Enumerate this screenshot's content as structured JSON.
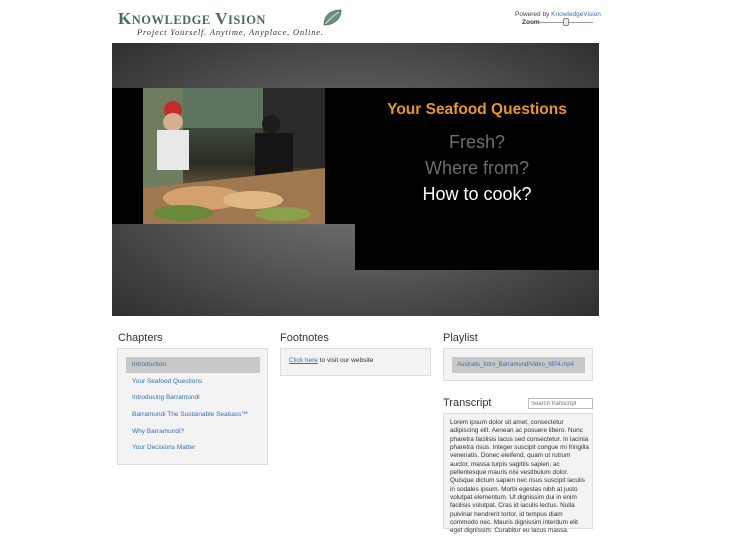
{
  "header": {
    "logo_first_letter": "K",
    "logo_first_rest": "NOWLEDGE",
    "logo_second_letter": "V",
    "logo_second_rest": "ISION",
    "tagline": "Project Yourself. Anytime, Anyplace, Online.",
    "powered_by_prefix": "Powered by ",
    "powered_by_link": "KnowledgeVision",
    "zoom_label": "Zoom",
    "zoom_level": 0.5
  },
  "slide": {
    "title": "Your Seafood Questions",
    "questions": [
      "Fresh?",
      "Where from?",
      "How to cook?"
    ]
  },
  "chapters": {
    "title": "Chapters",
    "items": [
      "Introduction",
      "Your Seafood Questions",
      "Introducing Barramundi",
      "Barramundi The Sustainable Seabass™",
      "Why Barramundi?",
      "Your Decisions Matter"
    ]
  },
  "footnotes": {
    "title": "Footnotes",
    "link_text": "Click here",
    "rest_text": " to visit our website"
  },
  "playlist": {
    "title": "Playlist",
    "items": [
      "Australis_Intro_BarramundiVideo_MP4.mp4"
    ]
  },
  "transcript": {
    "title": "Transcript",
    "search_placeholder": "Search transcript",
    "text": "Lorem ipsum dolor sit amet, consectetur adipiscing elit. Aenean ac posuere libero. Nunc pharetra facilisis lacus sed consectetur. In lacinia pharetra risus. Integer suscipit congue mi fringilla venenatis. Donec eleifend, quam ut rutrum auctor, massa turpis sagittis sapien, ac pellentesque mauris nisi vestibulum dolor. Quisque dictum sapien nec risus suscipit iaculis in sodales ipsum. Morbi egestas nibh at justo volutpat elementum. Ut dignissim dui in enim facilisis volutpat. Cras id iaculis lectus. Nulla pulvinar hendrerit tortor, id tempus diam commodo nec. Mauris dignissim interdum elit eget dignissim. Curabitur eu lacus massa."
  },
  "colors": {
    "accent_orange": "#e6962d",
    "link_blue": "#3a6db0",
    "logo_green": "#4a6b5a"
  }
}
